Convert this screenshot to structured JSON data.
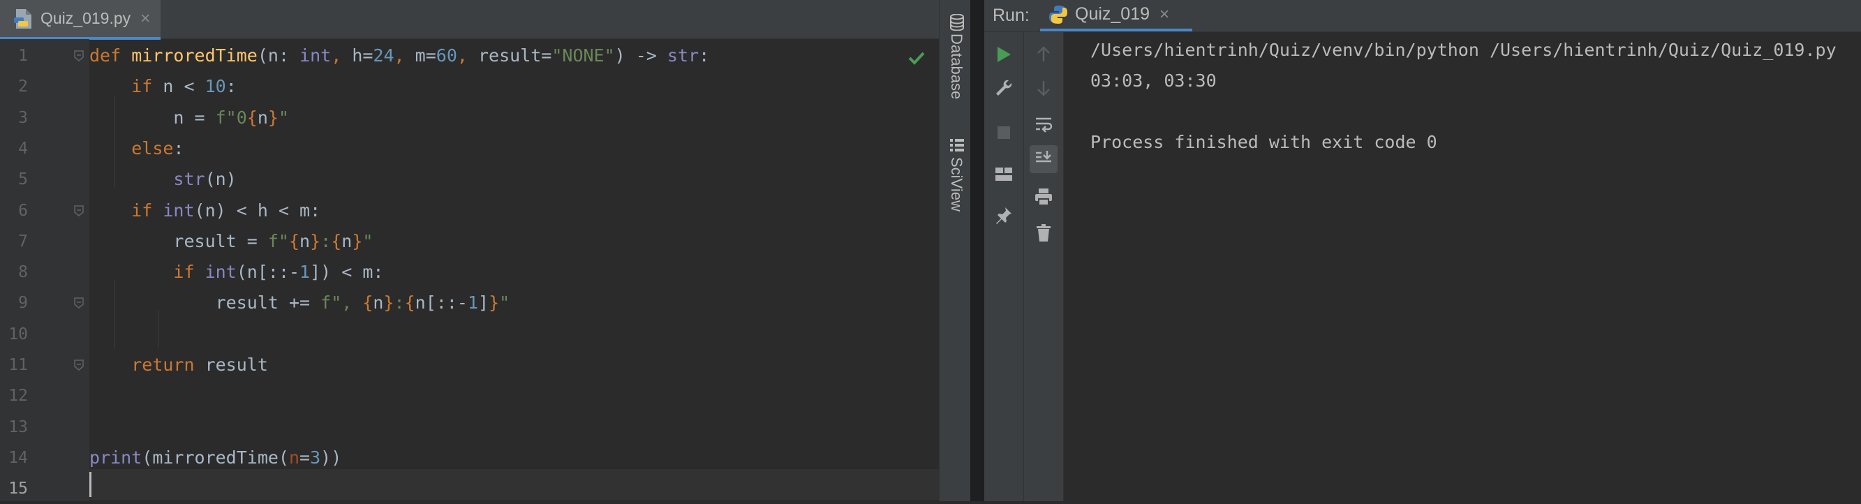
{
  "editor": {
    "file_tab": {
      "name": "Quiz_019.py",
      "close": "×"
    },
    "line_numbers": [
      "1",
      "2",
      "3",
      "4",
      "5",
      "6",
      "7",
      "8",
      "9",
      "10",
      "11",
      "12",
      "13",
      "14",
      "15"
    ],
    "current_line": 15,
    "code_lines": [
      [
        {
          "t": "def ",
          "c": "kw"
        },
        {
          "t": "mirroredTime",
          "c": "fn"
        },
        {
          "t": "(n: "
        },
        {
          "t": "int",
          "c": "bi"
        },
        {
          "t": ", ",
          "c": "kw"
        },
        {
          "t": "h="
        },
        {
          "t": "24",
          "c": "num"
        },
        {
          "t": ", ",
          "c": "kw"
        },
        {
          "t": "m="
        },
        {
          "t": "60",
          "c": "num"
        },
        {
          "t": ", ",
          "c": "kw"
        },
        {
          "t": "result="
        },
        {
          "t": "\"NONE\"",
          "c": "str"
        },
        {
          "t": ") -> "
        },
        {
          "t": "str",
          "c": "bi"
        },
        {
          "t": ":"
        }
      ],
      [
        {
          "t": "    "
        },
        {
          "t": "if ",
          "c": "kw"
        },
        {
          "t": "n < "
        },
        {
          "t": "10",
          "c": "num"
        },
        {
          "t": ":"
        }
      ],
      [
        {
          "t": "        n = "
        },
        {
          "t": "f\"0",
          "c": "str"
        },
        {
          "t": "{",
          "c": "brc"
        },
        {
          "t": "n"
        },
        {
          "t": "}",
          "c": "brc"
        },
        {
          "t": "\"",
          "c": "str"
        }
      ],
      [
        {
          "t": "    "
        },
        {
          "t": "else",
          "c": "kw"
        },
        {
          "t": ":"
        }
      ],
      [
        {
          "t": "        "
        },
        {
          "t": "str",
          "c": "bi"
        },
        {
          "t": "(n)"
        }
      ],
      [
        {
          "t": "    "
        },
        {
          "t": "if ",
          "c": "kw"
        },
        {
          "t": "int",
          "c": "bi"
        },
        {
          "t": "(n) < h < m:"
        }
      ],
      [
        {
          "t": "        result = "
        },
        {
          "t": "f\"",
          "c": "str"
        },
        {
          "t": "{",
          "c": "brc"
        },
        {
          "t": "n"
        },
        {
          "t": "}",
          "c": "brc"
        },
        {
          "t": ":",
          "c": "str"
        },
        {
          "t": "{",
          "c": "brc"
        },
        {
          "t": "n"
        },
        {
          "t": "}",
          "c": "brc"
        },
        {
          "t": "\"",
          "c": "str"
        }
      ],
      [
        {
          "t": "        "
        },
        {
          "t": "if ",
          "c": "kw"
        },
        {
          "t": "int",
          "c": "bi"
        },
        {
          "t": "(n[::-"
        },
        {
          "t": "1",
          "c": "num"
        },
        {
          "t": "]) < m:"
        }
      ],
      [
        {
          "t": "            result += "
        },
        {
          "t": "f\", ",
          "c": "str"
        },
        {
          "t": "{",
          "c": "brc"
        },
        {
          "t": "n"
        },
        {
          "t": "}",
          "c": "brc"
        },
        {
          "t": ":",
          "c": "str"
        },
        {
          "t": "{",
          "c": "brc"
        },
        {
          "t": "n[::-"
        },
        {
          "t": "1",
          "c": "num"
        },
        {
          "t": "]"
        },
        {
          "t": "}",
          "c": "brc"
        },
        {
          "t": "\"",
          "c": "str"
        }
      ],
      [
        {
          "t": ""
        }
      ],
      [
        {
          "t": "    "
        },
        {
          "t": "return ",
          "c": "kw"
        },
        {
          "t": "result"
        }
      ],
      [
        {
          "t": ""
        }
      ],
      [
        {
          "t": ""
        }
      ],
      [
        {
          "t": "print",
          "c": "bi"
        },
        {
          "t": "(mirroredTime("
        },
        {
          "t": "n",
          "c": "prm"
        },
        {
          "t": "="
        },
        {
          "t": "3",
          "c": "num"
        },
        {
          "t": "))"
        }
      ],
      [
        {
          "t": ""
        }
      ]
    ]
  },
  "side_tools": [
    {
      "name": "database-tab",
      "label": "Database",
      "icon": "database-icon"
    },
    {
      "name": "sciview-tab",
      "label": "SciView",
      "icon": "sciview-icon"
    }
  ],
  "run_panel": {
    "label": "Run:",
    "tab": {
      "name": "Quiz_019",
      "close": "×"
    },
    "console_lines": [
      "/Users/hientrinh/Quiz/venv/bin/python /Users/hientrinh/Quiz/Quiz_019.py",
      "03:03, 03:30",
      "",
      "Process finished with exit code 0"
    ]
  },
  "colors": {
    "keyword": "#cc7832",
    "function": "#ffc66d",
    "builtin": "#8888c6",
    "number": "#6897bb",
    "string": "#6a8759",
    "run_green": "#499c54",
    "accent": "#4a88c7"
  }
}
